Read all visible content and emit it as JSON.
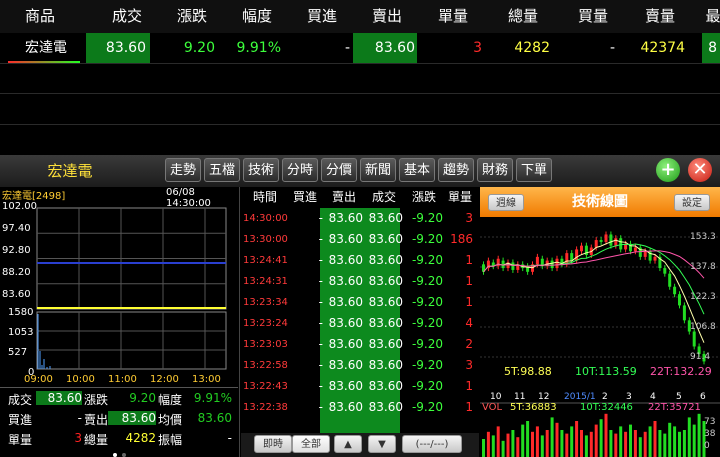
{
  "quote_header": [
    "商品",
    "成交",
    "漲跌",
    "幅度",
    "買進",
    "賣出",
    "單量",
    "總量",
    "買量",
    "賣量",
    "最"
  ],
  "quote_row": {
    "name": "宏達電",
    "price": "83.60",
    "change": "9.20",
    "pct": "9.91%",
    "bid": "-",
    "ask": "83.60",
    "lot": "3",
    "volume": "4282",
    "bid_qty": "-",
    "ask_qty": "42374",
    "extra": "8"
  },
  "toolbar": {
    "stock_name": "宏達電",
    "tabs": [
      "走勢",
      "五檔",
      "技術",
      "分時",
      "分價",
      "新聞",
      "基本",
      "趨勢",
      "財務",
      "下單"
    ],
    "add_icon": "plus-icon",
    "close_icon": "close-icon"
  },
  "left_panel": {
    "code": "宏達電[2498]",
    "datetime": "06/08 14:30:00",
    "price_ticks": [
      "102.00",
      "97.40",
      "92.80",
      "88.20",
      "83.60"
    ],
    "volume_ticks": [
      "1580",
      "1053",
      "527",
      "0"
    ],
    "time_ticks": [
      "09:00",
      "10:00",
      "11:00",
      "12:00",
      "13:00"
    ],
    "stats": [
      {
        "label": "成交",
        "value": "83.60",
        "label2": "漲跌",
        "value2": "9.20",
        "label3": "幅度",
        "value3": "9.91%"
      },
      {
        "label": "買進",
        "value": "-",
        "label2": "賣出",
        "value2": "83.60",
        "label3": "均價",
        "value3": "83.60"
      },
      {
        "label": "單量",
        "value": "3",
        "label2": "總量",
        "value2": "4282",
        "label3": "振幅",
        "value3": "-"
      }
    ],
    "colors": {
      "up": "#ff2222",
      "green": "#22cc22",
      "yellow": "#ffff33",
      "ref_line": "#2a3fd0"
    }
  },
  "mid_panel": {
    "headers": [
      "時間",
      "買進",
      "賣出",
      "成交",
      "漲跌",
      "單量"
    ],
    "rows": [
      [
        "14:30:00",
        "-",
        "83.60",
        "83.60",
        "-9.20",
        "3"
      ],
      [
        "13:30:00",
        "-",
        "83.60",
        "83.60",
        "-9.20",
        "186"
      ],
      [
        "13:24:41",
        "-",
        "83.60",
        "83.60",
        "-9.20",
        "1"
      ],
      [
        "13:24:31",
        "-",
        "83.60",
        "83.60",
        "-9.20",
        "1"
      ],
      [
        "13:23:34",
        "-",
        "83.60",
        "83.60",
        "-9.20",
        "1"
      ],
      [
        "13:23:24",
        "-",
        "83.60",
        "83.60",
        "-9.20",
        "4"
      ],
      [
        "13:23:03",
        "-",
        "83.60",
        "83.60",
        "-9.20",
        "2"
      ],
      [
        "13:22:58",
        "-",
        "83.60",
        "83.60",
        "-9.20",
        "3"
      ],
      [
        "13:22:43",
        "-",
        "83.60",
        "83.60",
        "-9.20",
        "1"
      ],
      [
        "13:22:38",
        "-",
        "83.60",
        "83.60",
        "-9.20",
        "1"
      ]
    ],
    "buttons": {
      "realtime": "即時",
      "all": "全部",
      "up": "▲",
      "down": "▼",
      "paging": "(---/---)"
    }
  },
  "right_panel": {
    "title": "技術線圖",
    "btn_left": "週線",
    "btn_right": "設定",
    "month_ticks": [
      "10",
      "11",
      "12",
      "2015/1",
      "2",
      "3",
      "4",
      "5",
      "6"
    ],
    "price_ticks": [
      "153.3",
      "137.8",
      "122.3",
      "106.8",
      "91.4"
    ],
    "ma_labels": [
      "5T:98.88",
      "10T:113.59",
      "22T:132.29"
    ],
    "vol_labels": [
      "VOL",
      "5T:36883",
      "10T:32446",
      "22T:35721"
    ],
    "vol_ticks": [
      "73",
      "38",
      "0"
    ]
  }
}
